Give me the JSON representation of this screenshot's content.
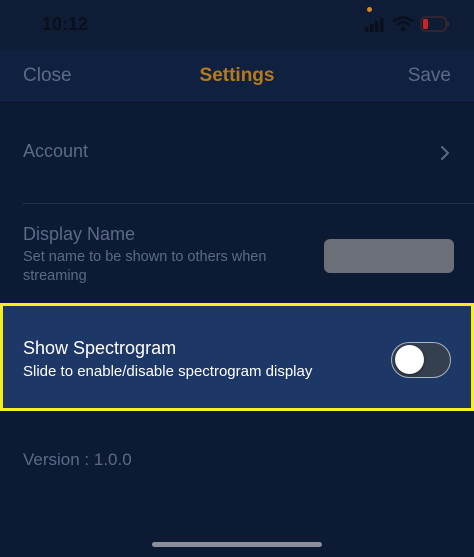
{
  "status_bar": {
    "time": "10:12",
    "icons": [
      "signal-icon",
      "wifi-icon",
      "battery-icon"
    ],
    "battery_color": "#d02020"
  },
  "nav": {
    "close_label": "Close",
    "title": "Settings",
    "save_label": "Save",
    "title_color": "#b77a1a"
  },
  "settings": {
    "account": {
      "label": "Account",
      "icon": "chevron-right-icon"
    },
    "display_name": {
      "label": "Display Name",
      "description": "Set name to be shown to others when streaming",
      "value": ""
    },
    "spectrogram": {
      "label": "Show Spectrogram",
      "description": "Slide to enable/disable spectrogram display",
      "enabled": false,
      "highlight_color": "#f5ef1c"
    }
  },
  "version": "Version : 1.0.0"
}
